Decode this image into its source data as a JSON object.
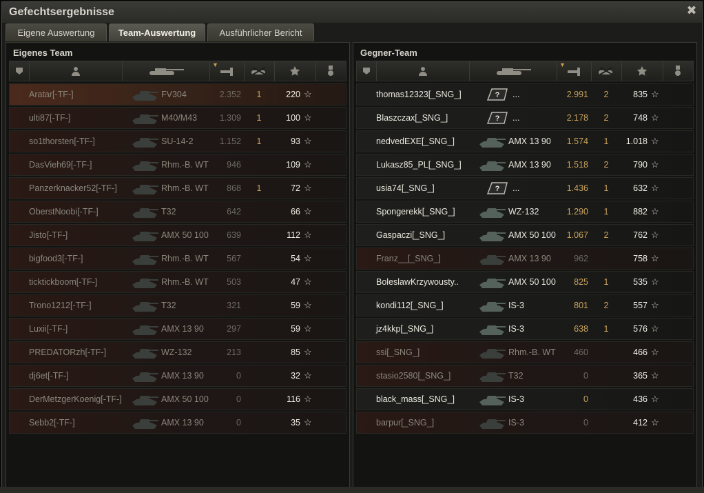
{
  "window": {
    "title": "Gefechtsergebnisse",
    "close_glyph": "✖"
  },
  "tabs": [
    {
      "label": "Eigene Auswertung",
      "active": false
    },
    {
      "label": "Team-Auswertung",
      "active": true
    },
    {
      "label": "Ausführlicher Bericht",
      "active": false
    }
  ],
  "own_team": {
    "title": "Eigenes Team",
    "players": [
      {
        "name": "Aratar[-TF-]",
        "tank": "FV304",
        "damage": "2.352",
        "kills": "1",
        "xp": "220",
        "dead": true
      },
      {
        "name": "ulti87[-TF-]",
        "tank": "M40/M43",
        "damage": "1.309",
        "kills": "1",
        "xp": "100",
        "dead": true
      },
      {
        "name": "so1thorsten[-TF-]",
        "tank": "SU-14-2",
        "damage": "1.152",
        "kills": "1",
        "xp": "93",
        "dead": true
      },
      {
        "name": "DasVieh69[-TF-]",
        "tank": "Rhm.-B. WT",
        "damage": "946",
        "kills": "",
        "xp": "109",
        "dead": true
      },
      {
        "name": "Panzerknacker52[-TF-]",
        "tank": "Rhm.-B. WT",
        "damage": "868",
        "kills": "1",
        "xp": "72",
        "dead": true
      },
      {
        "name": "OberstNoobi[-TF-]",
        "tank": "T32",
        "damage": "642",
        "kills": "",
        "xp": "66",
        "dead": true
      },
      {
        "name": "Jisto[-TF-]",
        "tank": "AMX 50 100",
        "damage": "639",
        "kills": "",
        "xp": "112",
        "dead": true
      },
      {
        "name": "bigfood3[-TF-]",
        "tank": "Rhm.-B. WT",
        "damage": "567",
        "kills": "",
        "xp": "54",
        "dead": true
      },
      {
        "name": "ticktickboom[-TF-]",
        "tank": "Rhm.-B. WT",
        "damage": "503",
        "kills": "",
        "xp": "47",
        "dead": true
      },
      {
        "name": "Trono1212[-TF-]",
        "tank": "T32",
        "damage": "321",
        "kills": "",
        "xp": "59",
        "dead": true
      },
      {
        "name": "Luxii[-TF-]",
        "tank": "AMX 13 90",
        "damage": "297",
        "kills": "",
        "xp": "59",
        "dead": true
      },
      {
        "name": "PREDATORzh[-TF-]",
        "tank": "WZ-132",
        "damage": "213",
        "kills": "",
        "xp": "85",
        "dead": true
      },
      {
        "name": "dj6et[-TF-]",
        "tank": "AMX 13 90",
        "damage": "0",
        "kills": "",
        "xp": "32",
        "dead": true
      },
      {
        "name": "DerMetzgerKoenig[-TF-]",
        "tank": "AMX 50 100",
        "damage": "0",
        "kills": "",
        "xp": "116",
        "dead": true
      },
      {
        "name": "Sebb2[-TF-]",
        "tank": "AMX 13 90",
        "damage": "0",
        "kills": "",
        "xp": "35",
        "dead": true
      }
    ]
  },
  "enemy_team": {
    "title": "Gegner-Team",
    "players": [
      {
        "name": "thomas12323[_SNG_]",
        "tank": "...",
        "damage": "2.991",
        "kills": "2",
        "xp": "835",
        "dead": false,
        "unknown": true
      },
      {
        "name": "Blaszczax[_SNG_]",
        "tank": "...",
        "damage": "2.178",
        "kills": "2",
        "xp": "748",
        "dead": false,
        "unknown": true
      },
      {
        "name": "nedvedEXE[_SNG_]",
        "tank": "AMX 13 90",
        "damage": "1.574",
        "kills": "1",
        "xp": "1.018",
        "dead": false
      },
      {
        "name": "Lukasz85_PL[_SNG_]",
        "tank": "AMX 13 90",
        "damage": "1.518",
        "kills": "2",
        "xp": "790",
        "dead": false
      },
      {
        "name": "usia74[_SNG_]",
        "tank": "...",
        "damage": "1.436",
        "kills": "1",
        "xp": "632",
        "dead": false,
        "unknown": true
      },
      {
        "name": "Spongerekk[_SNG_]",
        "tank": "WZ-132",
        "damage": "1.290",
        "kills": "1",
        "xp": "882",
        "dead": false
      },
      {
        "name": "Gaspaczi[_SNG_]",
        "tank": "AMX 50 100",
        "damage": "1.067",
        "kills": "2",
        "xp": "762",
        "dead": false
      },
      {
        "name": "Franz__[_SNG_]",
        "tank": "AMX 13 90",
        "damage": "962",
        "kills": "",
        "xp": "758",
        "dead": true
      },
      {
        "name": "BoleslawKrzywousty..",
        "tank": "AMX 50 100",
        "damage": "825",
        "kills": "1",
        "xp": "535",
        "dead": false
      },
      {
        "name": "kondi112[_SNG_]",
        "tank": "IS-3",
        "damage": "801",
        "kills": "2",
        "xp": "557",
        "dead": false
      },
      {
        "name": "jz4kkp[_SNG_]",
        "tank": "IS-3",
        "damage": "638",
        "kills": "1",
        "xp": "576",
        "dead": false
      },
      {
        "name": "ssi[_SNG_]",
        "tank": "Rhm.-B. WT",
        "damage": "460",
        "kills": "",
        "xp": "466",
        "dead": true
      },
      {
        "name": "stasio2580[_SNG_]",
        "tank": "T32",
        "damage": "0",
        "kills": "",
        "xp": "365",
        "dead": true
      },
      {
        "name": "black_mass[_SNG_]",
        "tank": "IS-3",
        "damage": "0",
        "kills": "",
        "xp": "436",
        "dead": false
      },
      {
        "name": "barpur[_SNG_]",
        "tank": "IS-3",
        "damage": "0",
        "kills": "",
        "xp": "412",
        "dead": true
      }
    ]
  },
  "colors": {
    "accent": "#c9a35c",
    "dead_row": "#2a1914",
    "alive_row": "#1e1e1c"
  },
  "icons": {
    "squad": "squad-icon",
    "player": "player-icon",
    "tank": "tank-icon",
    "damage": "damage-icon",
    "kills": "kills-icon",
    "xp": "xp-star-icon",
    "medal": "medal-icon"
  }
}
